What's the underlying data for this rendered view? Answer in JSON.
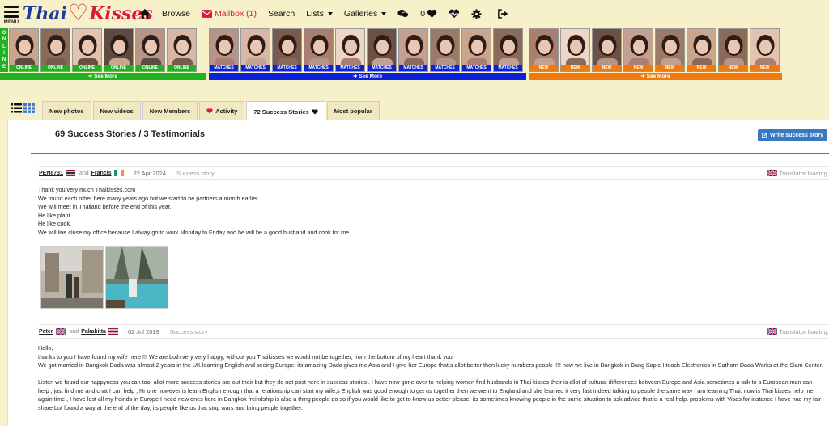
{
  "header": {
    "menu_label": "MENU",
    "logo_left": "Thai",
    "logo_right": "Kisses",
    "nav": {
      "browse": "Browse",
      "mailbox": "Mailbox (1)",
      "search": "Search",
      "lists": "Lists",
      "galleries": "Galleries",
      "likes_count": "0"
    }
  },
  "strips": {
    "online_side": [
      "O",
      "N",
      "L",
      "I",
      "N",
      "E"
    ],
    "online_tag": "ONLINE",
    "matches_tag": "MATCHES",
    "new_tag": "NEW",
    "see_more": "See More",
    "colors": {
      "online": "#21b121",
      "matches": "#0b22d8",
      "new": "#f07a10"
    }
  },
  "tabs": [
    {
      "label": "New photos"
    },
    {
      "label": "New videos"
    },
    {
      "label": "New Members"
    },
    {
      "label": "Activity"
    },
    {
      "label": "72 Success Stories"
    },
    {
      "label": "Most popular"
    }
  ],
  "page": {
    "title": "69 Success Stories / 3 Testimonials",
    "write_button": "Write success story"
  },
  "stories": [
    {
      "user1": "PEN8731",
      "and": "and",
      "user2": "Francis",
      "date": "22 Apr 2024",
      "type": "Success story",
      "translator": "Translator loading...",
      "lines": [
        "Thank you very much Thaikisses.com",
        "We found each other here many years ago but we start to be partners a month earlier.",
        "We will meet in Thailand before the end of this year.",
        "He like plant.",
        "He like cook.",
        "We will live close my office because I alway go to work Monday to Friday and he will be a good husband and cook for me."
      ]
    },
    {
      "user1": "Peter",
      "and": "and",
      "user2": "Pakakitta",
      "date": "02 Jul 2019",
      "type": "Success story",
      "translator": "Translator loading...",
      "lines": [
        "Hello,",
        "thanks to you I have found my wife here !!! We are both very very happy, without you Thaikisses we would not be together, from the bottom of my heart thank you!",
        "We got married in Bangkok Dada was almost 2 years in the UK learning English and seeing Europe. its amazing Dada gives me Asia and I give her Europe that,s allot better then lucky numbers people !!!! now we live in Bangkok in Bang Kapie I teach Electronics in Sathorn Dada Works at the Siam Center.",
        "",
        "Listen we found our happyness you can too, allot more success stories are out their but they do not post here in success stories . I have now gone over to helping women find husbands in Thai kisses their is allot of cultural differences between Europe and Asia sometimes a talk to a European man can help , just find me and chat I can help , Nr one however is learn English enough that a relationship can start my wife,s English was good enough to get us together then we went to England and she learned it very fast indeed talking to people the same way I am learning Thai. now is Thai kisses help me again time , I have lost all my freinds in Europe I need new ones here in Bangkok freindship is also a thing people do so if you would like to get to know us better please! its sometimes knowing people in the same situation to ask advice that is a real help. problems with Visas for instance I have had my fair share but found a way at the end of the day, its people like us that stop wars and bring people together."
      ]
    }
  ]
}
